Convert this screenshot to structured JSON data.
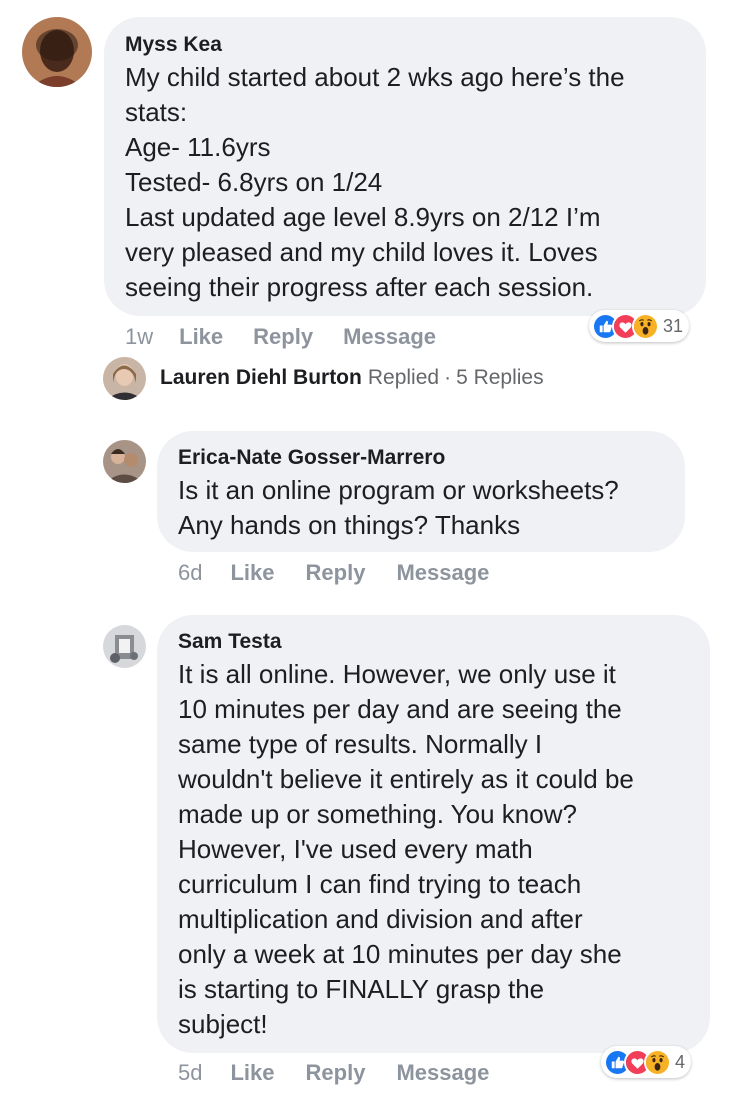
{
  "comments": [
    {
      "author": "Myss Kea",
      "text": "My child started about 2 wks ago here’s the\nstats:\nAge- 11.6yrs\nTested- 6.8yrs on 1/24\nLast updated age level 8.9yrs on 2/12 I’m\nvery pleased and my child loves it. Loves\nseeing their progress after each session.",
      "time": "1w",
      "like_label": "Like",
      "reply_label": "Reply",
      "message_label": "Message",
      "reaction_count": "31",
      "reactions": [
        "like-icon",
        "love-icon",
        "wow-icon"
      ]
    },
    {
      "author": "Erica-Nate Gosser-Marrero",
      "text": "Is it an online program or worksheets?\nAny hands on things? Thanks",
      "time": "6d",
      "like_label": "Like",
      "reply_label": "Reply",
      "message_label": "Message"
    },
    {
      "author": "Sam Testa",
      "text": "It is all online. However, we only use it\n10 minutes per day and are seeing the\nsame type of results. Normally I\nwouldn't believe it entirely as it could be\nmade up or something. You know?\nHowever, I've used every math\ncurriculum I can find trying to teach\nmultiplication and division and after\nonly a week at 10 minutes per day she\nis starting to FINALLY grasp the\nsubject!",
      "time": "5d",
      "like_label": "Like",
      "reply_label": "Reply",
      "message_label": "Message",
      "reaction_count": "4",
      "reactions": [
        "like-icon",
        "love-icon",
        "wow-icon"
      ]
    }
  ],
  "replies_summary": {
    "author": "Lauren Diehl Burton",
    "action": "Replied",
    "separator": "·",
    "count_text": "5 Replies"
  },
  "colors": {
    "bubble": "#f0f1f4",
    "like_blue": "#1877f2",
    "love_red": "#f33e58",
    "wow_yellow": "#f7b125",
    "meta_gray": "#8d949e"
  }
}
